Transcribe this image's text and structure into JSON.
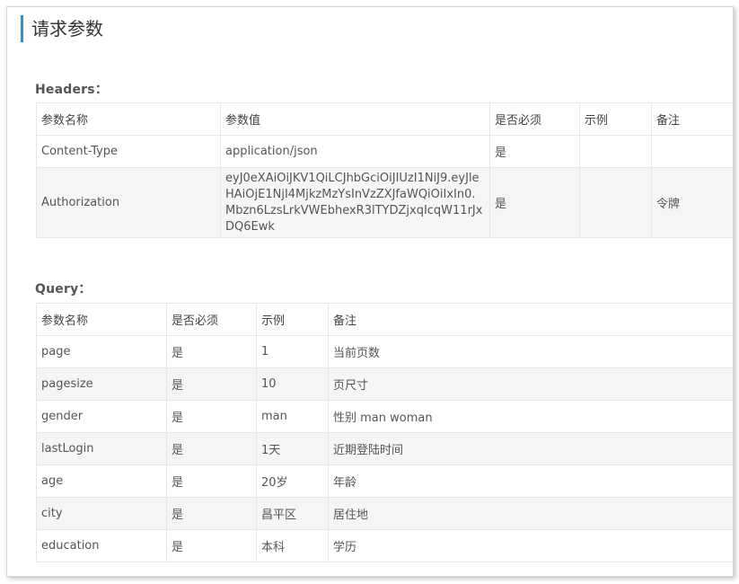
{
  "page_title": "请求参数",
  "headers_section": {
    "title": "Headers：",
    "columns": [
      "参数名称",
      "参数值",
      "是否必须",
      "示例",
      "备注"
    ],
    "rows": [
      [
        "Content-Type",
        "application/json",
        "是",
        "",
        ""
      ],
      [
        "Authorization",
        "eyJ0eXAiOiJKV1QiLCJhbGciOiJIUzI1NiJ9.eyJleHAiOjE1NjI4MjkzMzYsInVzZXJfaWQiOiIxIn0.Mbzn6LzsLrkVWEbhexR3lTYDZjxqIcqW11rJxDQ6Ewk",
        "是",
        "",
        "令牌"
      ]
    ]
  },
  "query_section": {
    "title": "Query：",
    "columns": [
      "参数名称",
      "是否必须",
      "示例",
      "备注"
    ],
    "rows": [
      [
        "page",
        "是",
        "1",
        "当前页数"
      ],
      [
        "pagesize",
        "是",
        "10",
        "页尺寸"
      ],
      [
        "gender",
        "是",
        "man",
        "性别 man woman"
      ],
      [
        "lastLogin",
        "是",
        "1天",
        "近期登陆时间"
      ],
      [
        "age",
        "是",
        "20岁",
        "年龄"
      ],
      [
        "city",
        "是",
        "昌平区",
        "居住地"
      ],
      [
        "education",
        "是",
        "本科",
        "学历"
      ]
    ]
  },
  "colors": {
    "accent": "#2f8fd8",
    "border": "#e6e6e6",
    "alt_row": "#f5f5f5"
  }
}
